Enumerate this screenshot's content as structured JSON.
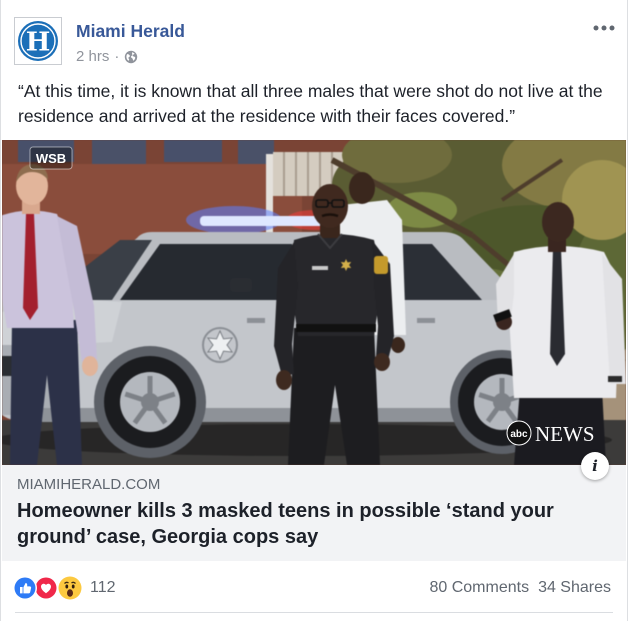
{
  "colors": {
    "page_bg": "#ffffff",
    "name_blue": "#385898",
    "meta_gray": "#90949c",
    "text": "#1d2129",
    "secondary_text": "#606770",
    "preview_bg": "#f2f3f5",
    "divider": "#dadde1",
    "like_blue": "#2e7bf6",
    "love_red": "#f0284a",
    "wow_yellow": "#fcc940",
    "logo_blue": "#1b6fb8"
  },
  "header": {
    "logo_icon": "miami-herald-logo",
    "logo_letter": "H",
    "page_name": "Miami Herald",
    "timestamp": "2 hrs",
    "separator": "·",
    "audience_icon": "globe-icon",
    "more_icon": "more-options-icon"
  },
  "post_text": "“At this time, it is known that all three males that were shot do not live at the residence and arrived at the residence with their faces covered.”",
  "link_preview": {
    "photo": {
      "watermark_top_left": "WSB",
      "watermark_bottom_right_logo": "abc",
      "watermark_bottom_right_text": "NEWS"
    },
    "info_button_label": "i",
    "domain": "MIAMIHERALD.COM",
    "headline": "Homeowner kills 3 masked teens in possible ‘stand your ground’ case, Georgia cops say"
  },
  "engagement": {
    "reaction_icons": [
      "like-icon",
      "love-icon",
      "wow-icon"
    ],
    "reaction_count": "112",
    "comments": "80 Comments",
    "shares": "34 Shares"
  }
}
